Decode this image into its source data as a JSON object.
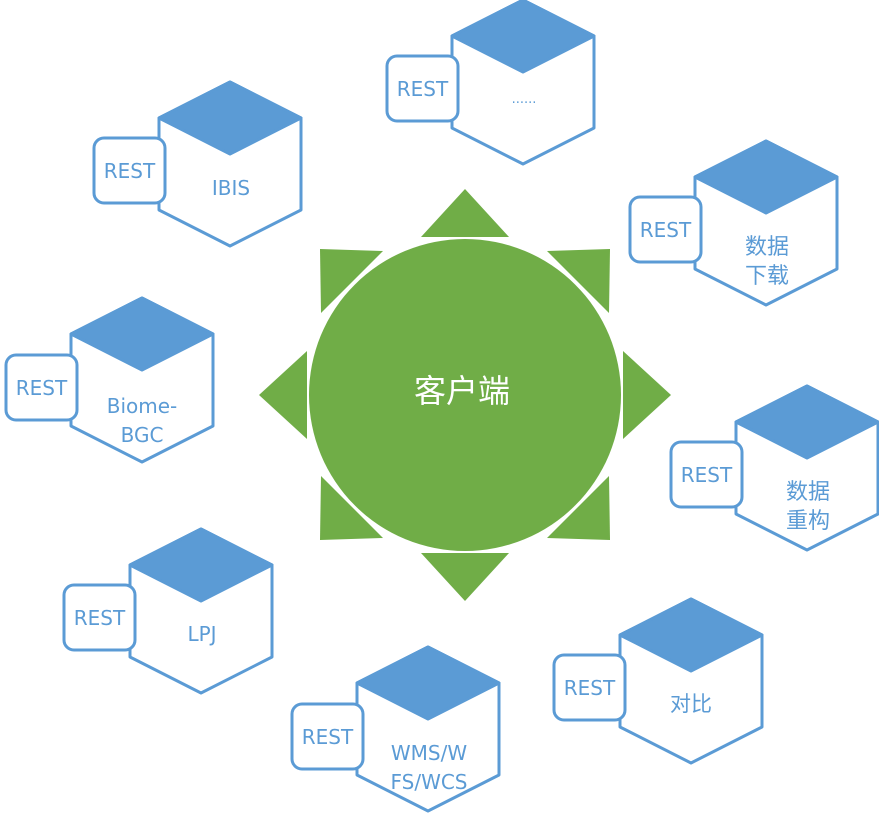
{
  "center": {
    "label": "客户端",
    "color": "#70ad47",
    "text_color": "#ffffff"
  },
  "colors": {
    "cube_stroke": "#5b9bd5",
    "cube_top": "#5b9bd5",
    "cube_face": "#ffffff",
    "text": "#5b9bd5"
  },
  "services": [
    {
      "id": "more",
      "rest_label": "REST",
      "label_lines": [
        "......"
      ]
    },
    {
      "id": "ibis",
      "rest_label": "REST",
      "label_lines": [
        "IBIS"
      ]
    },
    {
      "id": "download",
      "rest_label": "REST",
      "label_lines": [
        "数据",
        "下载"
      ]
    },
    {
      "id": "biome-bgc",
      "rest_label": "REST",
      "label_lines": [
        "Biome-",
        "BGC"
      ]
    },
    {
      "id": "reconstruct",
      "rest_label": "REST",
      "label_lines": [
        "数据",
        "重构"
      ]
    },
    {
      "id": "lpj",
      "rest_label": "REST",
      "label_lines": [
        "LPJ"
      ]
    },
    {
      "id": "compare",
      "rest_label": "REST",
      "label_lines": [
        "对比"
      ]
    },
    {
      "id": "wms",
      "rest_label": "REST",
      "label_lines": [
        "WMS/W",
        "FS/WCS"
      ]
    }
  ]
}
